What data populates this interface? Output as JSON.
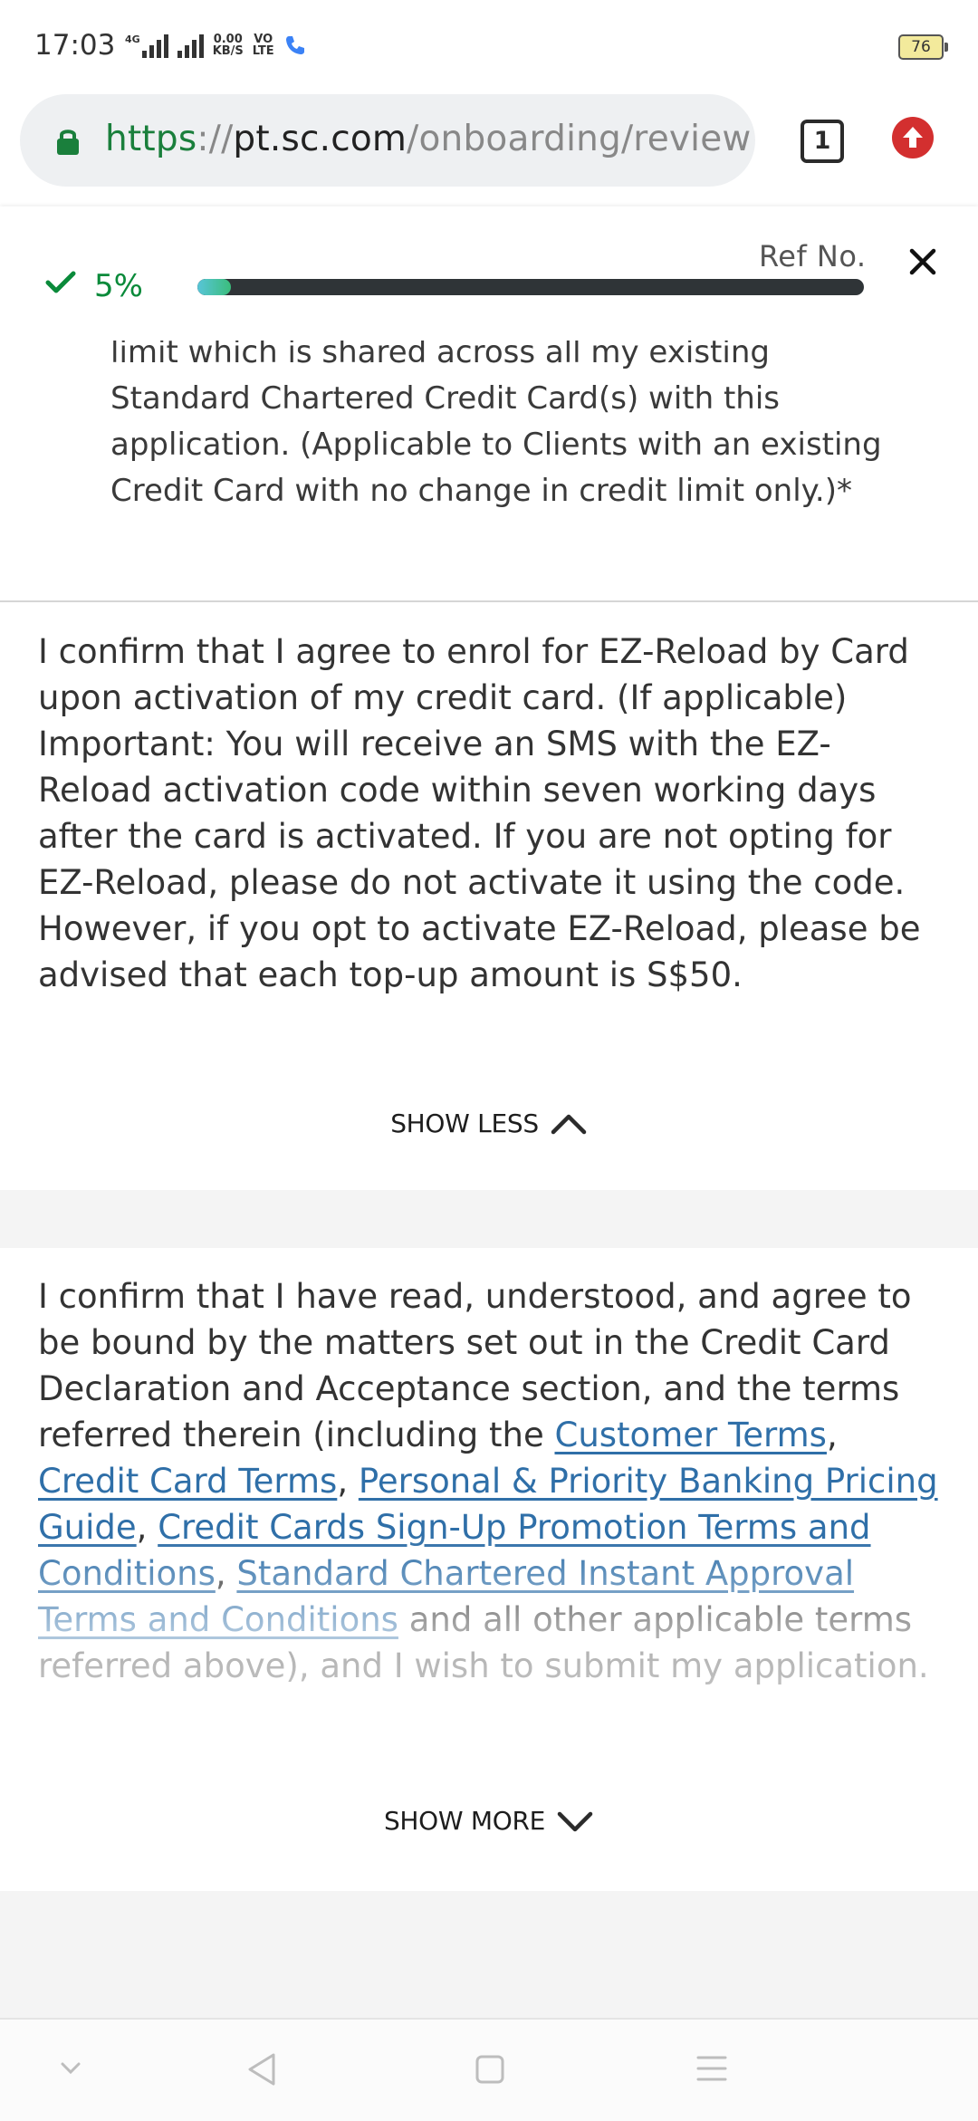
{
  "status_bar": {
    "time": "17:03",
    "network": "4G",
    "speed_value": "0.00",
    "speed_unit": "KB/S",
    "volte_top": "VO",
    "volte_bottom": "LTE",
    "battery": "76"
  },
  "browser": {
    "url_protocol": "https",
    "url_separator": "://",
    "url_host": "pt.sc.com",
    "url_path": "/onboarding/review",
    "tab_count": "1",
    "colors": {
      "secure": "#1a7f3c",
      "update": "#d32f2f"
    }
  },
  "header": {
    "progress_label": "5%",
    "progress_value": 0.05,
    "ref_label": "Ref No.",
    "colors": {
      "accent": "#0a8a3a",
      "progress_start": "#58c5d8",
      "progress_end": "#3bbd7c",
      "track": "#2f3437"
    }
  },
  "content": {
    "clause_fragment": "limit which is shared across all my existing Standard Chartered Credit Card(s) with this application. (Applicable to Clients with an existing Credit Card with no change in credit limit only.)*",
    "ez_reload_text": "I confirm that I agree to enrol for EZ-Reload by Card upon activation of my credit card. (If applicable) Important: You will receive an SMS with the EZ-Reload activation code within seven working days after the card is activated. If you are not opting for EZ-Reload, please do not activate it using the code. However, if you opt to activate EZ-Reload, please be advised that each top-up amount is S$50.",
    "show_less_label": "SHOW LESS",
    "declaration": {
      "intro": "I confirm that I have read, understood, and agree to be bound by the matters set out in the Credit Card Declaration and Acceptance section, and the terms referred therein (including the ",
      "link_customer_terms": "Customer Terms",
      "sep1": ", ",
      "link_credit_card_terms": "Credit Card Terms",
      "sep2": ", ",
      "link_pricing_guide": "Personal & Priority Banking Pricing Guide",
      "sep3": ", ",
      "link_signup_promo": "Credit Cards Sign-Up Promotion Terms and Conditions",
      "sep4": ", ",
      "link_instant_approval": "Standard Chartered Instant Approval Terms and Conditions",
      "outro": " and all other applicable terms referred above), and I wish to submit my application."
    },
    "show_more_label": "SHOW MORE"
  },
  "nav_bar": {
    "icons": [
      "chevron-down-icon",
      "back-icon",
      "home-icon",
      "menu-icon"
    ]
  }
}
